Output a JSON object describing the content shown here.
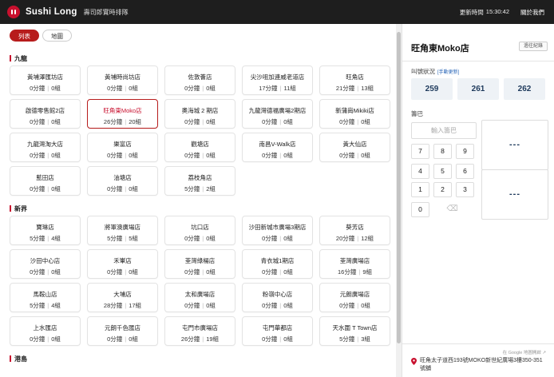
{
  "header": {
    "brand": "Sushi Long",
    "subtitle": "壽司郎實時排隊",
    "time_label": "更新時間",
    "time_value": "15:30:42",
    "about": "關於我們"
  },
  "view_tabs": [
    {
      "label": "列表",
      "active": true
    },
    {
      "label": "地圖",
      "active": false
    }
  ],
  "regions": [
    {
      "name": "九龍",
      "stores": [
        {
          "name": "黃埔澤匯坊店",
          "wait": "0分鐘",
          "groups": "0組"
        },
        {
          "name": "黃埔時尚坊店",
          "wait": "0分鐘",
          "groups": "0組"
        },
        {
          "name": "佐敦薈店",
          "wait": "0分鐘",
          "groups": "0組"
        },
        {
          "name": "尖沙咀加連威老道店",
          "wait": "17分鐘",
          "groups": "11組"
        },
        {
          "name": "旺角店",
          "wait": "21分鐘",
          "groups": "13組"
        },
        {
          "name": "啟德零售館2店",
          "wait": "0分鐘",
          "groups": "0組"
        },
        {
          "name": "旺角東Moko店",
          "wait": "26分鐘",
          "groups": "20組",
          "selected": true
        },
        {
          "name": "奧海城 2 期店",
          "wait": "0分鐘",
          "groups": "0組"
        },
        {
          "name": "九龍灣德福廣場2期店",
          "wait": "0分鐘",
          "groups": "0組"
        },
        {
          "name": "新蒲崗Mikiki店",
          "wait": "0分鐘",
          "groups": "0組"
        },
        {
          "name": "九龍灣淘大店",
          "wait": "0分鐘",
          "groups": "0組"
        },
        {
          "name": "樂富店",
          "wait": "0分鐘",
          "groups": "0組"
        },
        {
          "name": "觀塘店",
          "wait": "0分鐘",
          "groups": "0組"
        },
        {
          "name": "南昌V-Walk店",
          "wait": "0分鐘",
          "groups": "0組"
        },
        {
          "name": "黃大仙店",
          "wait": "0分鐘",
          "groups": "0組"
        },
        {
          "name": "藍田店",
          "wait": "0分鐘",
          "groups": "0組"
        },
        {
          "name": "油塘店",
          "wait": "0分鐘",
          "groups": "0組"
        },
        {
          "name": "荔枝角店",
          "wait": "5分鐘",
          "groups": "2組"
        }
      ]
    },
    {
      "name": "新界",
      "stores": [
        {
          "name": "寶琳店",
          "wait": "5分鐘",
          "groups": "4組"
        },
        {
          "name": "將軍澳廣場店",
          "wait": "5分鐘",
          "groups": "5組"
        },
        {
          "name": "坑口店",
          "wait": "0分鐘",
          "groups": "0組"
        },
        {
          "name": "沙田新城市廣場3期店",
          "wait": "0分鐘",
          "groups": "0組"
        },
        {
          "name": "葵芳店",
          "wait": "20分鐘",
          "groups": "12組"
        },
        {
          "name": "沙田中心店",
          "wait": "0分鐘",
          "groups": "0組"
        },
        {
          "name": "禾輋店",
          "wait": "0分鐘",
          "groups": "0組"
        },
        {
          "name": "荃灣綠楊店",
          "wait": "0分鐘",
          "groups": "0組"
        },
        {
          "name": "青衣城1期店",
          "wait": "0分鐘",
          "groups": "0組"
        },
        {
          "name": "荃灣廣場店",
          "wait": "16分鐘",
          "groups": "9組"
        },
        {
          "name": "馬鞍山店",
          "wait": "5分鐘",
          "groups": "4組"
        },
        {
          "name": "大埔店",
          "wait": "28分鐘",
          "groups": "17組"
        },
        {
          "name": "太和廣場店",
          "wait": "0分鐘",
          "groups": "0組"
        },
        {
          "name": "粉嶺中心店",
          "wait": "0分鐘",
          "groups": "0組"
        },
        {
          "name": "元朗廣場店",
          "wait": "0分鐘",
          "groups": "0組"
        },
        {
          "name": "上水匯店",
          "wait": "0分鐘",
          "groups": "0組"
        },
        {
          "name": "元朗千色匯店",
          "wait": "0分鐘",
          "groups": "0組"
        },
        {
          "name": "屯門市廣場店",
          "wait": "26分鐘",
          "groups": "19組"
        },
        {
          "name": "屯門華都店",
          "wait": "0分鐘",
          "groups": "0組"
        },
        {
          "name": "天水圍 T Town店",
          "wait": "5分鐘",
          "groups": "3組"
        }
      ]
    },
    {
      "name": "港島",
      "stores": []
    }
  ],
  "detail": {
    "title": "旺角東Moko店",
    "history_button": "過往紀錄",
    "calling_label": "叫號狀況",
    "manual_update": "[手動更新]",
    "calling_numbers": [
      "259",
      "261",
      "262"
    ],
    "queue_label": "籌巴",
    "queue_placeholder": "輸入籌巴",
    "keys": [
      "7",
      "8",
      "9",
      "4",
      "5",
      "6",
      "1",
      "2",
      "3",
      "0"
    ],
    "delete_key": "⌫",
    "result_top": "---",
    "result_bottom": "---",
    "map_link": "在 Google 地圖開啟 ↗",
    "address": "旺角太子道西193號MOKO新世紀廣場3樓350-351號舖"
  },
  "colors": {
    "accent": "#c8102e",
    "topbar": "#1e1e1e",
    "number_text": "#1e3a5c"
  }
}
